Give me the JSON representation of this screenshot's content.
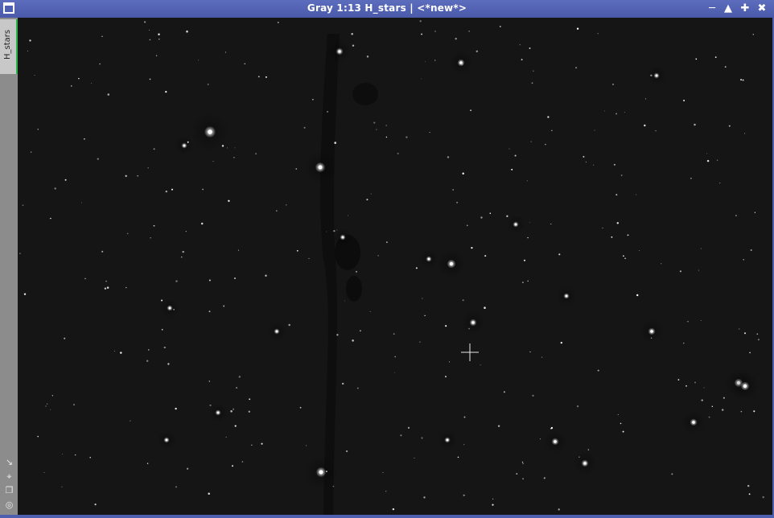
{
  "window": {
    "title": "Gray 1:13 H_stars | <*new*>"
  },
  "controls": {
    "minimize_icon": "minimize-icon",
    "shade_icon": "shade-icon",
    "maximize_icon": "maximize-icon",
    "close_icon": "close-icon"
  },
  "sidebar": {
    "tab_label": "H_stars",
    "tools": [
      "fit-view-icon",
      "zoom-icon",
      "clone-icon",
      "mask-icon"
    ]
  },
  "image": {
    "name": "H_stars",
    "mode": "Gray",
    "zoom": "1:13",
    "background_color": "#141414",
    "star_color": "#ffffff"
  },
  "colors": {
    "frame": "#4f5fb0",
    "tab_accent": "#2bb34a"
  }
}
